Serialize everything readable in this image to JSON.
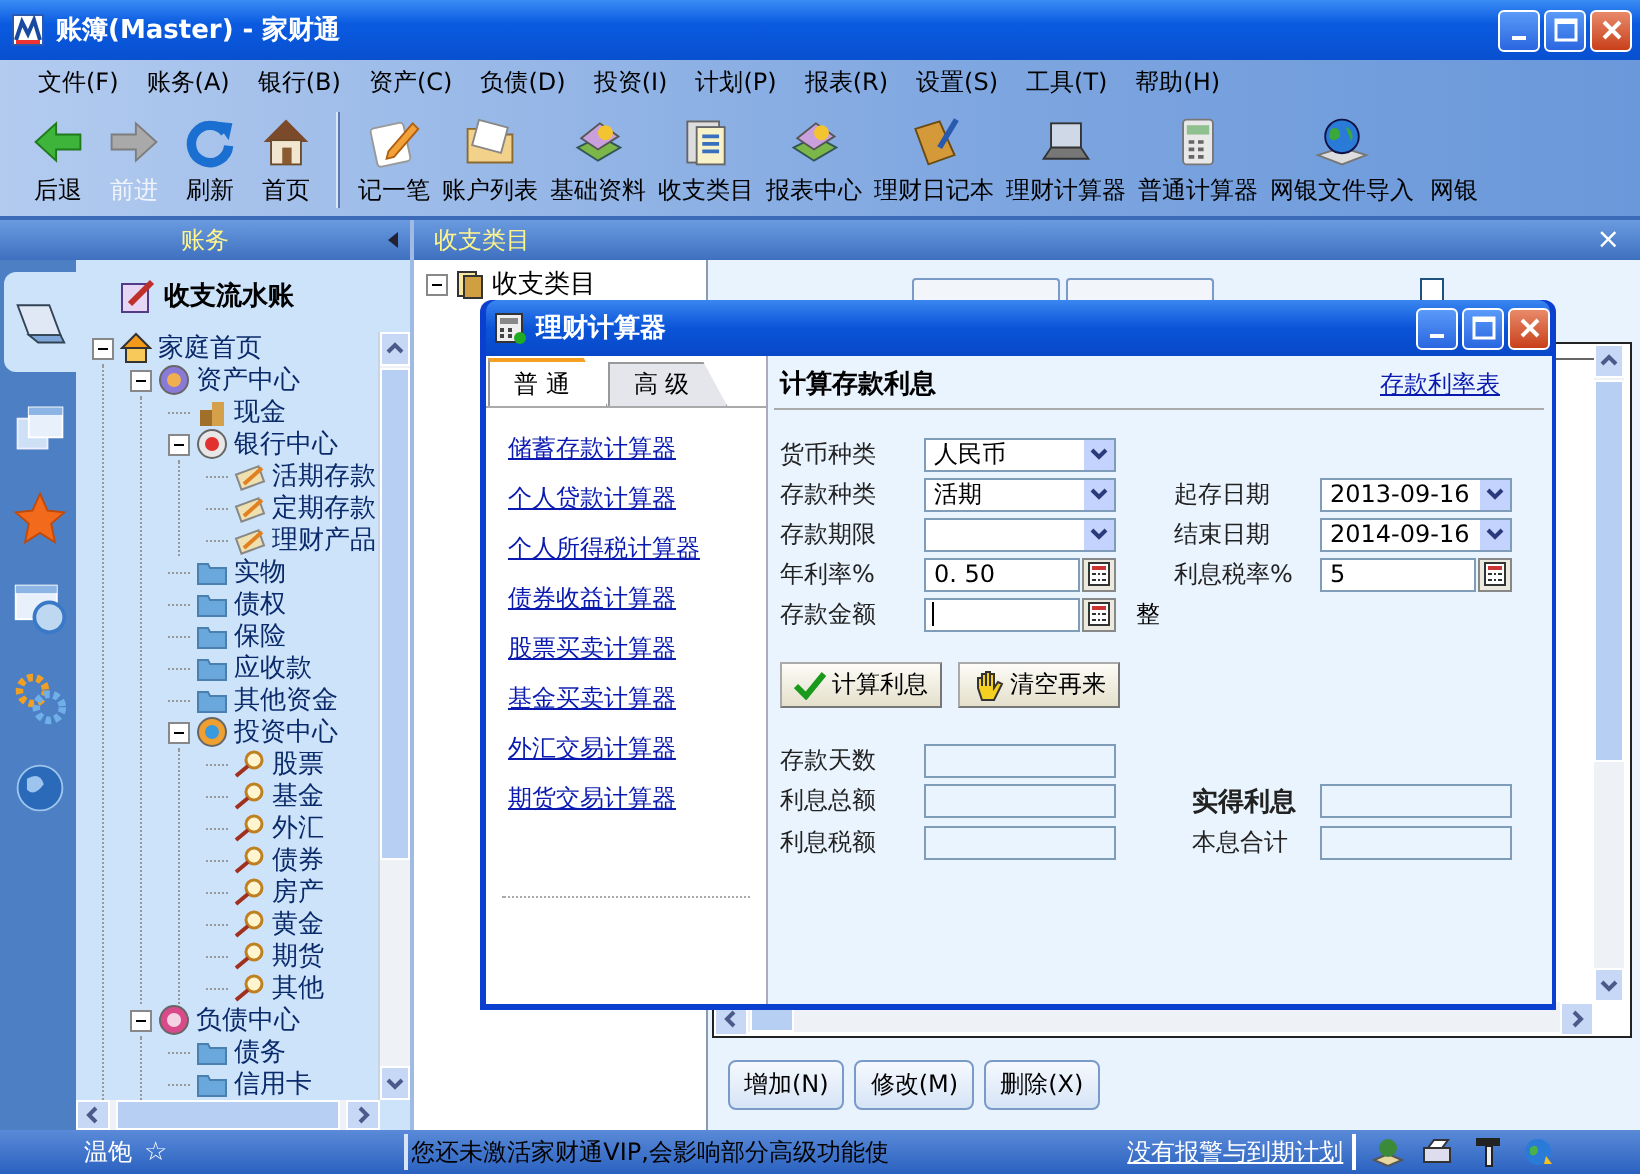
{
  "window": {
    "title": "账簿(Master) - 家财通"
  },
  "menu": [
    "文件(F)",
    "账务(A)",
    "银行(B)",
    "资产(C)",
    "负债(D)",
    "投资(I)",
    "计划(P)",
    "报表(R)",
    "设置(S)",
    "工具(T)",
    "帮助(H)"
  ],
  "toolbar": {
    "nav_buttons": [
      {
        "label": "后退",
        "disabled": false
      },
      {
        "label": "前进",
        "disabled": true
      },
      {
        "label": "刷新",
        "disabled": false
      },
      {
        "label": "首页",
        "disabled": false
      }
    ],
    "tools": [
      {
        "label": "记一笔"
      },
      {
        "label": "账户列表"
      },
      {
        "label": "基础资料"
      },
      {
        "label": "收支类目"
      },
      {
        "label": "报表中心"
      },
      {
        "label": "理财日记本"
      },
      {
        "label": "理财计算器"
      },
      {
        "label": "普通计算器"
      },
      {
        "label": "网银文件导入"
      },
      {
        "label": "网银"
      }
    ]
  },
  "left_panel": {
    "title": "账务",
    "nav": [
      {
        "selected": true
      },
      {
        "selected": false
      },
      {
        "selected": false
      },
      {
        "selected": false
      },
      {
        "selected": false
      },
      {
        "selected": false
      }
    ],
    "heading": "收支流水账",
    "tree": [
      {
        "label": "家庭首页",
        "kind": "home",
        "expanded": true,
        "children": [
          {
            "label": "资产中心",
            "kind": "hub",
            "expanded": true,
            "children": [
              {
                "label": "现金",
                "kind": "cash"
              },
              {
                "label": "银行中心",
                "kind": "bank",
                "expanded": true,
                "children": [
                  {
                    "label": "活期存款",
                    "kind": "card"
                  },
                  {
                    "label": "定期存款",
                    "kind": "card"
                  },
                  {
                    "label": "理财产品",
                    "kind": "card"
                  }
                ]
              },
              {
                "label": "实物",
                "kind": "folder"
              },
              {
                "label": "债权",
                "kind": "folder"
              },
              {
                "label": "保险",
                "kind": "folder"
              },
              {
                "label": "应收款",
                "kind": "folder"
              },
              {
                "label": "其他资金",
                "kind": "folder"
              },
              {
                "label": "投资中心",
                "kind": "invest",
                "expanded": true,
                "children": [
                  {
                    "label": "股票",
                    "kind": "lens"
                  },
                  {
                    "label": "基金",
                    "kind": "lens"
                  },
                  {
                    "label": "外汇",
                    "kind": "lens"
                  },
                  {
                    "label": "债券",
                    "kind": "lens"
                  },
                  {
                    "label": "房产",
                    "kind": "lens"
                  },
                  {
                    "label": "黄金",
                    "kind": "lens"
                  },
                  {
                    "label": "期货",
                    "kind": "lens"
                  },
                  {
                    "label": "其他",
                    "kind": "lens"
                  }
                ]
              }
            ]
          },
          {
            "label": "负债中心",
            "kind": "debt",
            "expanded": true,
            "children": [
              {
                "label": "债务",
                "kind": "folder"
              },
              {
                "label": "信用卡",
                "kind": "folder"
              }
            ]
          }
        ]
      }
    ]
  },
  "content_panel": {
    "title": "收支类目",
    "close": "×",
    "tree": [
      {
        "label": "收支类目",
        "expanded": true
      }
    ],
    "show_hidden": {
      "checked": false
    },
    "buttons": [
      "增加(N)",
      "修改(M)",
      "删除(X)"
    ]
  },
  "dialog": {
    "title": "理财计算器",
    "tabs": [
      {
        "label": "普 通",
        "selected": true
      },
      {
        "label": "高 级",
        "selected": false
      }
    ],
    "links": [
      "储蓄存款计算器",
      "个人贷款计算器",
      "个人所得税计算器",
      "债券收益计算器",
      "股票买卖计算器",
      "基金买卖计算器",
      "外汇交易计算器",
      "期货交易计算器"
    ],
    "form_title": "计算存款利息",
    "rate_link": "存款利率表",
    "left_fields": [
      {
        "label": "货币种类",
        "kind": "select",
        "value": "人民币"
      },
      {
        "label": "存款种类",
        "kind": "select",
        "value": "活期"
      },
      {
        "label": "存款期限",
        "kind": "select"
      },
      {
        "label": "年利率%",
        "kind": "calc",
        "value": "0. 50"
      },
      {
        "label": "存款金额",
        "kind": "calc",
        "focused": true,
        "unit": "整"
      }
    ],
    "right_fields": [
      {
        "label": "起存日期",
        "kind": "select",
        "value": "2013-09-16"
      },
      {
        "label": "结束日期",
        "kind": "select",
        "value": "2014-09-16"
      },
      {
        "label": "利息税率%",
        "kind": "calc",
        "value": "5"
      }
    ],
    "actions": [
      {
        "label": "计算利息",
        "kind": "check"
      },
      {
        "label": "清空再来",
        "kind": "hand"
      }
    ],
    "left_results": [
      {
        "label": "存款天数"
      },
      {
        "label": "利息总额"
      },
      {
        "label": "利息税额"
      }
    ],
    "right_results": [
      {
        "label": "实得利息",
        "strong": true
      },
      {
        "label": "本息合计",
        "strong": false
      }
    ]
  },
  "status_bar": {
    "level": "温饱",
    "star": "☆",
    "message": "您还未激活家财通VIP,会影响部分高级功能使",
    "link": "没有报警与到期计划"
  }
}
